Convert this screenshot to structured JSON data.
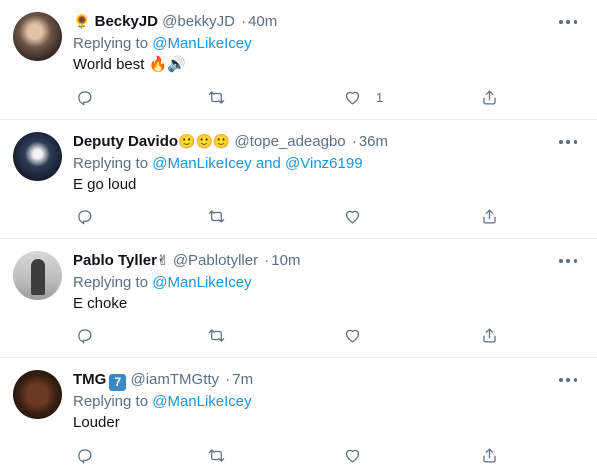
{
  "tweets": [
    {
      "emoji_before": "🌻",
      "name": "BeckyJD",
      "name_emojis": "",
      "badge": "",
      "handle": "@bekkyJD",
      "separator": "·",
      "time": "40m",
      "replying_prefix": "Replying to ",
      "mentions": [
        "@ManLikeIcey"
      ],
      "mention_joiner": "",
      "text": "World best 🔥🔊",
      "like_count": "1",
      "avatar_icon": "user-avatar"
    },
    {
      "emoji_before": "",
      "name": "Deputy Davido",
      "name_emojis": "🙂🙂🙂",
      "badge": "",
      "handle": "@tope_adeagbo",
      "separator": "·",
      "time": "36m",
      "replying_prefix": "Replying to ",
      "mentions": [
        "@ManLikeIcey",
        "@Vinz6199"
      ],
      "mention_joiner": " and ",
      "text": "E go loud",
      "like_count": "",
      "avatar_icon": "user-avatar"
    },
    {
      "emoji_before": "",
      "name": "Pablo Tyller",
      "name_emojis": "✌",
      "badge": "",
      "handle": "@Pablotyller",
      "separator": "·",
      "time": "10m",
      "replying_prefix": "Replying to ",
      "mentions": [
        "@ManLikeIcey"
      ],
      "mention_joiner": "",
      "text": "E choke",
      "like_count": "",
      "avatar_icon": "user-avatar"
    },
    {
      "emoji_before": "",
      "name": "TMG",
      "name_emojis": "",
      "badge": "7",
      "handle": "@iamTMGtty",
      "separator": "·",
      "time": "7m",
      "replying_prefix": "Replying to ",
      "mentions": [
        "@ManLikeIcey"
      ],
      "mention_joiner": "",
      "text": "Louder",
      "like_count": "",
      "avatar_icon": "user-avatar"
    }
  ],
  "icons": {
    "reply": "reply-icon",
    "retweet": "retweet-icon",
    "like": "heart-icon",
    "share": "share-icon",
    "more": "more-options-icon"
  },
  "colors": {
    "text": "#0f1419",
    "muted": "#5b7083",
    "link": "#1b95e0",
    "divider": "#e6ecf0",
    "badge": "#3b88c3"
  }
}
